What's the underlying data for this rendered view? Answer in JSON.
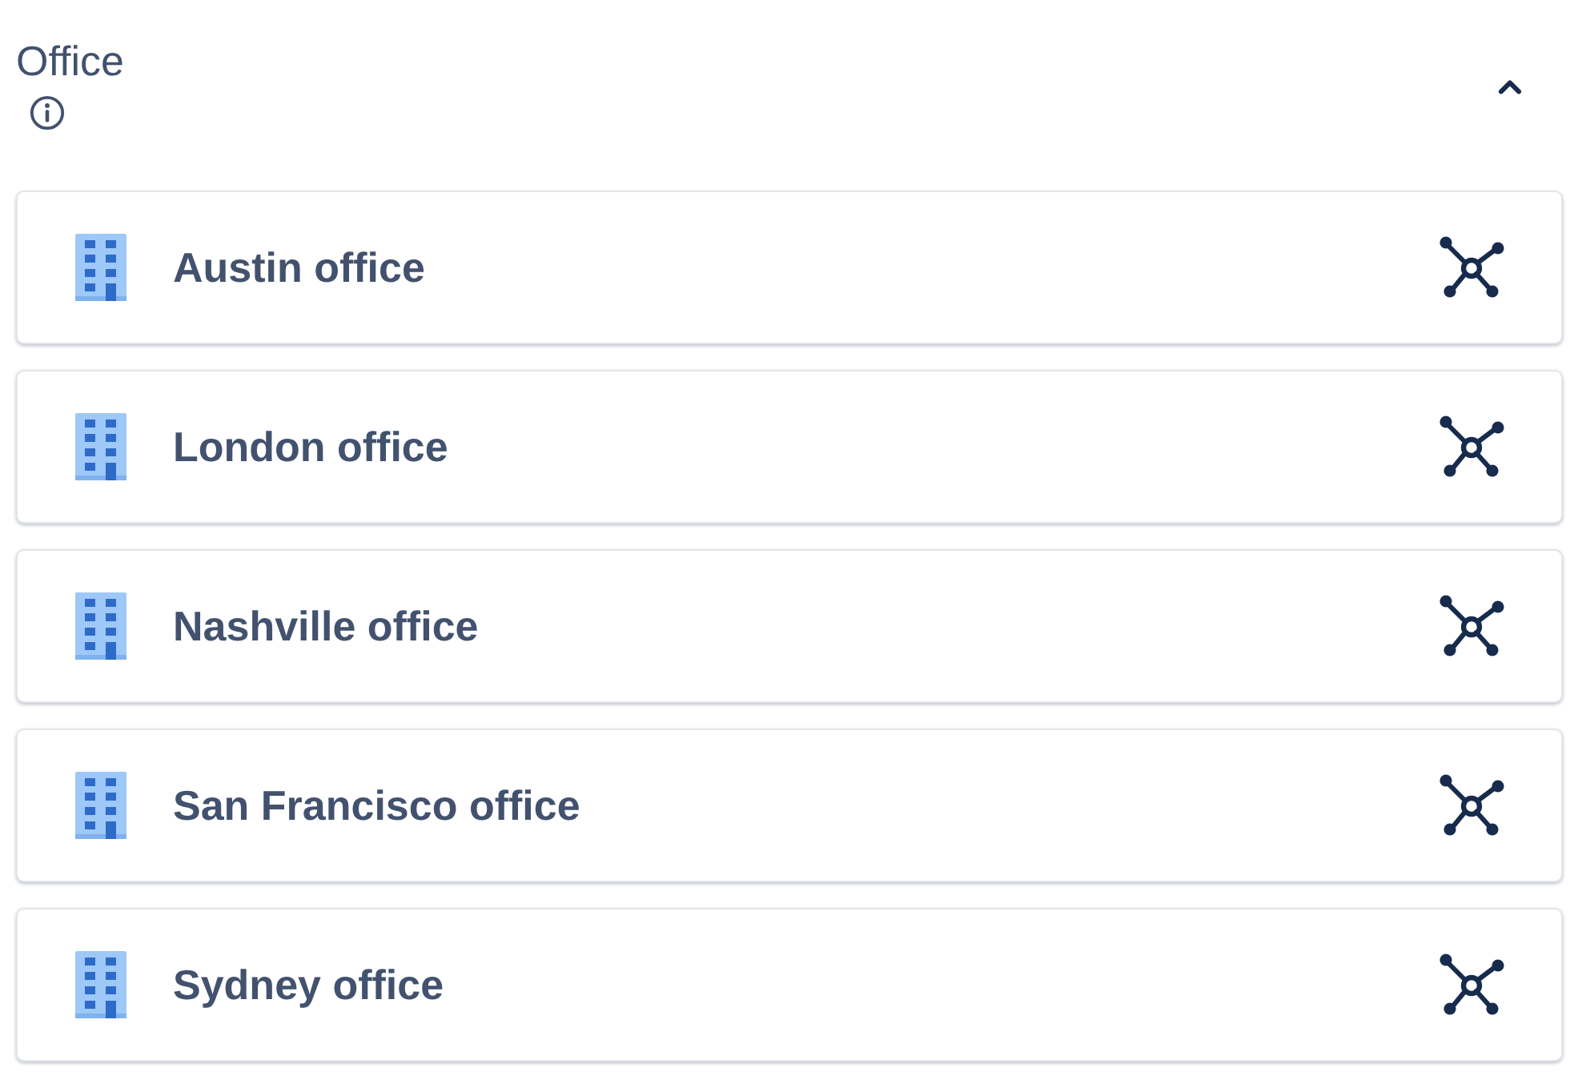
{
  "section": {
    "title": "Office",
    "expanded": true
  },
  "items": [
    {
      "label": "Austin office"
    },
    {
      "label": "London office"
    },
    {
      "label": "Nashville office"
    },
    {
      "label": "San Francisco office"
    },
    {
      "label": "Sydney office"
    }
  ]
}
